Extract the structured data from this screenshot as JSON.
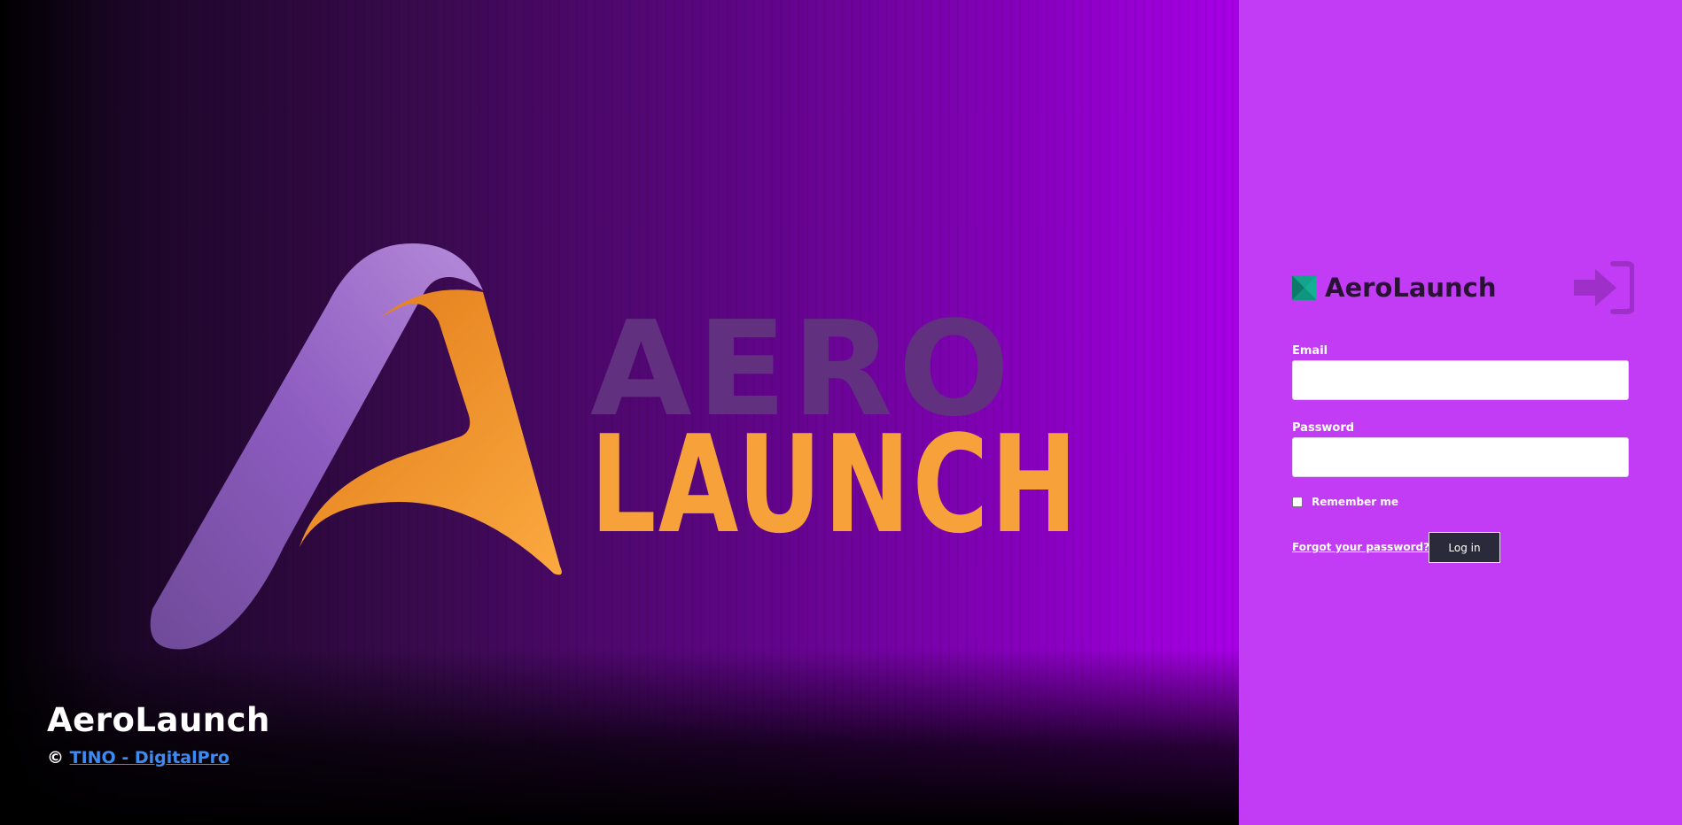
{
  "hero": {
    "logo_word_top": "AERO",
    "logo_word_bottom": "LAUNCH",
    "title": "AeroLaunch",
    "copyright_symbol": "©",
    "copyright_link": "TINO - DigitalPro"
  },
  "login": {
    "brand_name": "AeroLaunch",
    "brand_icon": "brand-logo-icon",
    "login_icon": "sign-in-icon",
    "email_label": "Email",
    "email_value": "",
    "password_label": "Password",
    "password_value": "",
    "remember_label": "Remember me",
    "remember_checked": false,
    "forgot_label": "Forgot your password?",
    "submit_label": "Log in"
  },
  "colors": {
    "panel_bg": "#c23bf5",
    "hero_gradient_end": "#a700e6",
    "logo_orange": "#f6a13a",
    "logo_purple": "#9b66c8",
    "button_bg": "#2a2a3a",
    "link_blue": "#3d8bf2"
  }
}
